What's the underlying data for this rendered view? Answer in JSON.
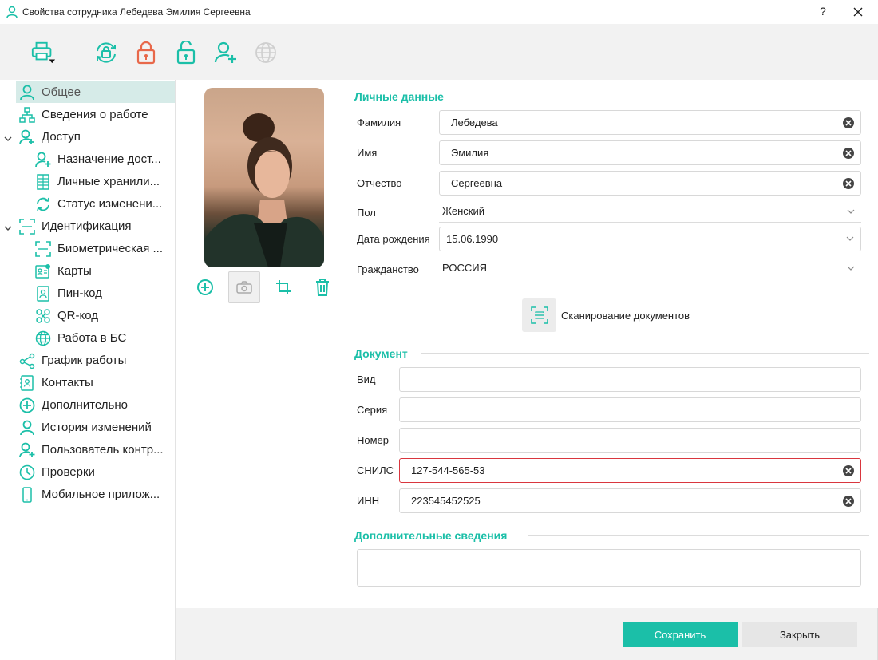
{
  "window": {
    "title": "Свойства сотрудника Лебедева  Эмилия  Сергеевна",
    "help_label": "?"
  },
  "toolbar": {
    "buttons": [
      "printer-icon",
      "sync-lock-icon",
      "lock-closed-icon",
      "lock-open-icon",
      "user-add-icon",
      "globe-icon"
    ]
  },
  "nav": {
    "items": [
      {
        "label": "Общее",
        "icon": "user-icon"
      },
      {
        "label": "Сведения о работе",
        "icon": "org-chart-icon"
      },
      {
        "label": "Доступ",
        "icon": "user-key-icon"
      },
      {
        "label": "Назначение дост...",
        "icon": "user-add-icon"
      },
      {
        "label": "Личные хранили...",
        "icon": "storage-grid-icon"
      },
      {
        "label": "Статус изменени...",
        "icon": "refresh-icon"
      },
      {
        "label": "Идентификация",
        "icon": "scan-frame-icon"
      },
      {
        "label": "Биометрическая ...",
        "icon": "scan-frame-icon"
      },
      {
        "label": "Карты",
        "icon": "id-card-icon"
      },
      {
        "label": "Пин-код",
        "icon": "pin-badge-icon"
      },
      {
        "label": "QR-код",
        "icon": "qr-code-icon"
      },
      {
        "label": "Работа в БС",
        "icon": "globe-icon"
      },
      {
        "label": "График работы",
        "icon": "share-icon"
      },
      {
        "label": "Контакты",
        "icon": "contacts-book-icon"
      },
      {
        "label": "Дополнительно",
        "icon": "plus-circle-icon"
      },
      {
        "label": "История изменений",
        "icon": "user-icon"
      },
      {
        "label": "Пользователь контр...",
        "icon": "user-add-icon"
      },
      {
        "label": "Проверки",
        "icon": "clock-icon"
      },
      {
        "label": "Мобильное прилож...",
        "icon": "mobile-icon"
      }
    ]
  },
  "personal": {
    "title": "Личные данные",
    "last_name_label": "Фамилия",
    "last_name": "Лебедева",
    "first_name_label": "Имя",
    "first_name": "Эмилия",
    "middle_name_label": "Отчество",
    "middle_name": "Сергеевна",
    "gender_label": "Пол",
    "gender": "Женский",
    "birth_label": "Дата рождения",
    "birth": "15.06.1990",
    "citizenship_label": "Гражданство",
    "citizenship": "РОССИЯ"
  },
  "scan": {
    "label": "Сканирование документов"
  },
  "document": {
    "title": "Документ",
    "type_label": "Вид",
    "type": "",
    "series_label": "Серия",
    "series": "",
    "number_label": "Номер",
    "number": "",
    "snils_label": "СНИЛС",
    "snils": "127-544-565-53",
    "inn_label": "ИНН",
    "inn": "223545452525"
  },
  "extra": {
    "title": "Дополнительные сведения",
    "text": ""
  },
  "footer": {
    "save_label": "Сохранить",
    "close_label": "Закрыть"
  },
  "colors": {
    "accent": "#1bbfa8",
    "lock_closed": "#e8684a",
    "error_border": "#d9363e",
    "nav_active_bg": "#d6ebe8"
  }
}
